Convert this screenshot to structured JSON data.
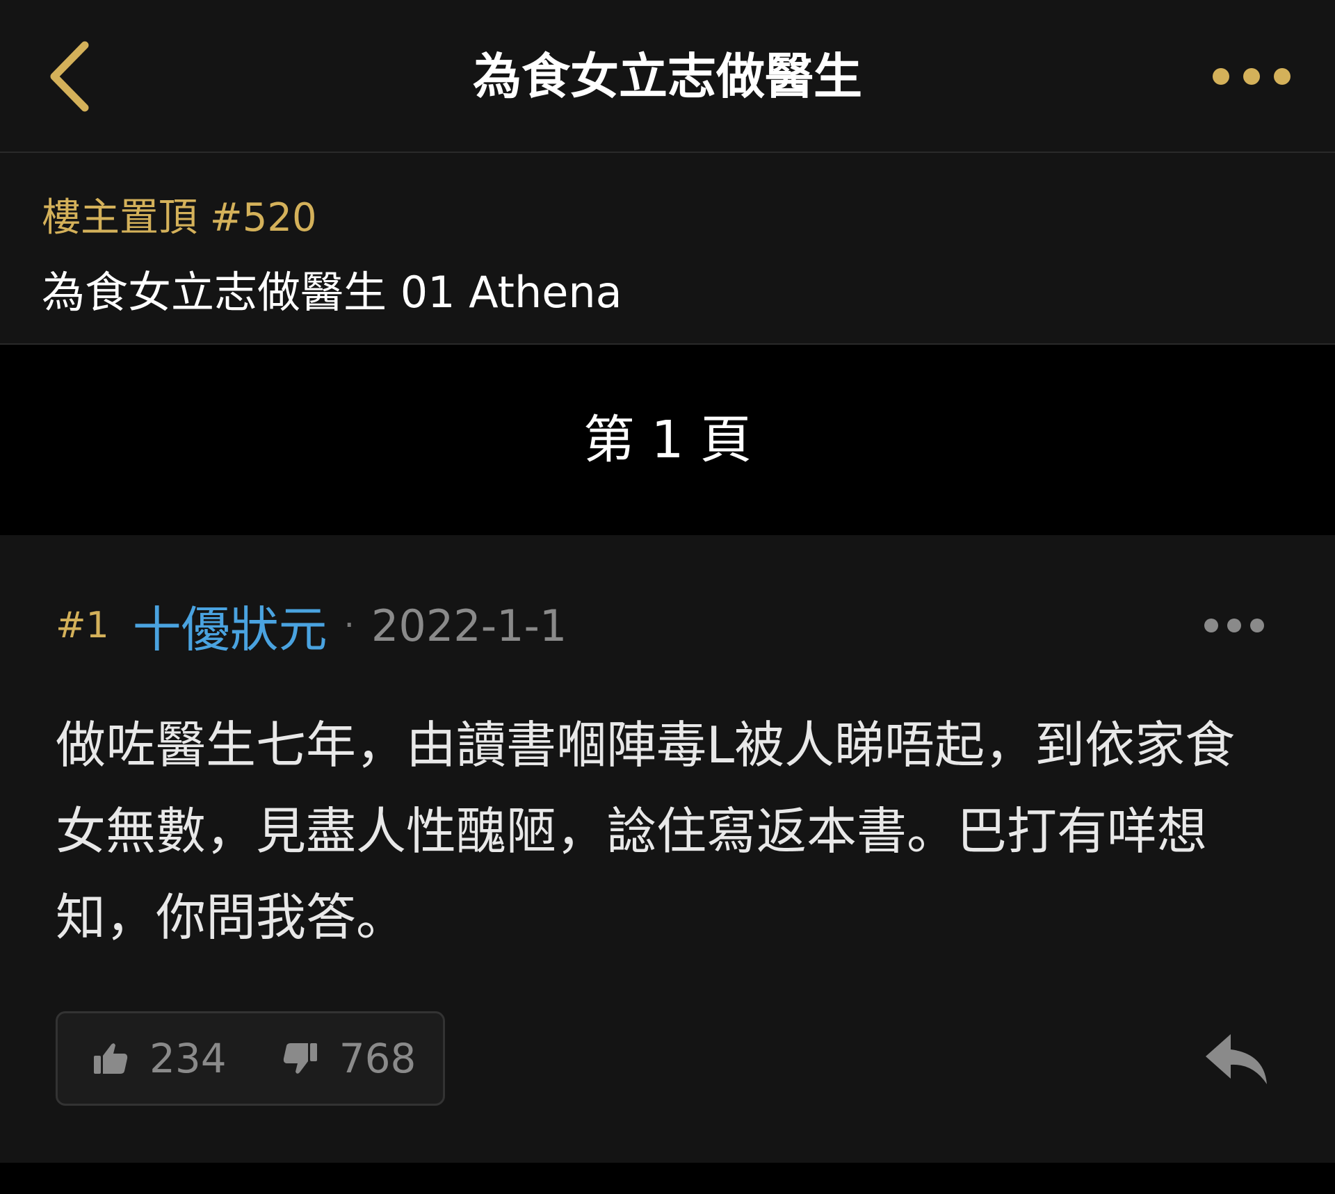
{
  "navbar": {
    "title": "為食女立志做醫生",
    "back_icon": "chevron-left-icon",
    "more_icon": "more-dots-icon"
  },
  "pinned": {
    "label": "樓主置頂 #520",
    "title": "為食女立志做醫生 01 Athena"
  },
  "page_divider": {
    "label": "第 1 頁"
  },
  "post": {
    "number": "#1",
    "author": "十優狀元",
    "separator": "·",
    "date": "2022-1-1",
    "body": "做咗醫生七年，由讀書嗰陣毒L被人睇唔起，到依家食女無數，見盡人性醜陋，諗住寫返本書。巴打有咩想知，你問我答。",
    "upvotes": "234",
    "downvotes": "768"
  },
  "colors": {
    "accent_gold": "#d4b15a",
    "author_blue": "#4aa3e0",
    "background": "#141414"
  }
}
